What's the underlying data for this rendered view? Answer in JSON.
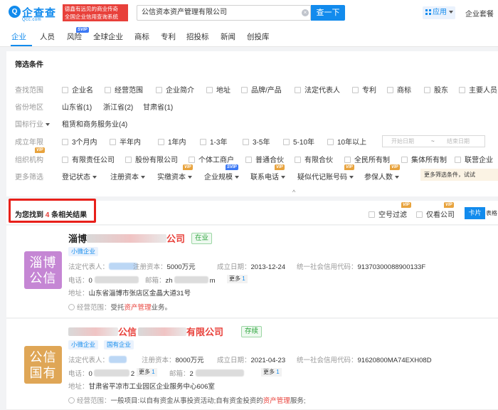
{
  "header": {
    "logo_mark": "Q",
    "logo_name": "企查查",
    "logo_domain": "Qcc.com",
    "slogan_line1": "德鑫有远见的商业传奇",
    "slogan_line2": "全国企业信用查询系统",
    "search_value": "公信资本资产管理有限公司",
    "search_button": "查一下",
    "app_button": "应用",
    "enterprise_kit": "企业套餐"
  },
  "nav": {
    "tabs": [
      "企业",
      "人员",
      "风险",
      "全球企业",
      "商标",
      "专利",
      "招投标",
      "新闻",
      "创投库"
    ],
    "risk_badge": "SVIP"
  },
  "filters": {
    "title": "筛选条件",
    "search_scope": {
      "label": "查找范围",
      "options": [
        "企业名",
        "经营范围",
        "企业简介",
        "地址",
        "品牌/产品",
        "法定代表人",
        "专利",
        "商标",
        "股东",
        "主要人员"
      ]
    },
    "province": {
      "label": "省份地区",
      "options": [
        "山东省(1)",
        "浙江省(2)",
        "甘肃省(1)"
      ]
    },
    "industry": {
      "label": "国标行业",
      "options": [
        "租赁和商务服务业(4)"
      ]
    },
    "established": {
      "label": "成立年限",
      "options": [
        "3个月内",
        "半年内",
        "1年内",
        "1-3年",
        "3-5年",
        "5-10年",
        "10年以上"
      ],
      "start_placeholder": "开始日期",
      "separator": "~",
      "end_placeholder": "结束日期"
    },
    "org_type": {
      "label": "组织机构",
      "badge": "VIP",
      "options": [
        "有限责任公司",
        "股份有限公司",
        "个体工商户",
        "普通合伙",
        "有限合伙",
        "全民所有制",
        "集体所有制",
        "联营企业"
      ]
    },
    "more": {
      "label": "更多筛选",
      "dropdowns": [
        "登记状态",
        "注册资本",
        "实缴资本",
        "企业规模",
        "联系电话",
        "疑似代记账号码",
        "参保人数"
      ],
      "badges": {
        "paid_capital": "VIP",
        "scale": "SVIP",
        "phone": "VIP",
        "bookkeeping": "VIP",
        "insured": "VIP"
      },
      "hint": "更多筛选条件，试试"
    },
    "collapse_icon": "^"
  },
  "results": {
    "prefix": "为您找到",
    "count": "4",
    "suffix": "条相关结果",
    "empty_filter": "空号过滤",
    "only_company": "仅看公司",
    "badge_vip": "VIP",
    "view_card": "卡片",
    "view_table": "表格"
  },
  "companies": [
    {
      "logo_line1": "淄博",
      "logo_line2": "公信",
      "name_prefix": "淄博",
      "name_suffix": "公司",
      "status": "在业",
      "tags": [
        "小微企业"
      ],
      "legal_rep_label": "法定代表人：",
      "reg_capital_label": "注册资本：",
      "reg_capital": "5000万元",
      "est_date_label": "成立日期：",
      "est_date": "2013-12-24",
      "credit_code_label": "统一社会信用代码：",
      "credit_code": "91370300088900133F",
      "phone_label": "电话：",
      "phone": "0",
      "email_label": "邮箱：",
      "email_start": "zh",
      "email_end": "m",
      "email_more": "更多",
      "email_more_n": "1",
      "address_label": "地址：",
      "address": "山东省淄博市张店区金晶大道31号",
      "scope_label": "经营范围：",
      "scope_pre": "受托",
      "scope_hl": "资产管理",
      "scope_post": "业务。"
    },
    {
      "logo_line1": "公信",
      "logo_line2": "国有",
      "name_mid": "公信",
      "name_tail": "有限公司",
      "status": "存续",
      "tags": [
        "小微企业",
        "国有企业"
      ],
      "legal_rep_label": "法定代表人：",
      "reg_capital_label": "注册资本：",
      "reg_capital": "8000万元",
      "est_date_label": "成立日期：",
      "est_date": "2021-04-23",
      "credit_code_label": "统一社会信用代码：",
      "credit_code": "91620800MA74EXH08D",
      "phone_label": "电话：",
      "phone_start": "0",
      "phone_end": "2",
      "phone_more": "更多",
      "phone_more_n": "1",
      "email_label": "邮箱：",
      "email_start": "2",
      "email_more": "更多",
      "email_more_n": "1",
      "address_label": "地址：",
      "address": "甘肃省平凉市工业园区企业服务中心606室",
      "scope_label": "经营范围：",
      "scope_pre": "一般项目:以自有资金从事投资活动;自有资金投资的",
      "scope_hl": "资产管理",
      "scope_post": "服务;"
    }
  ],
  "colors": {
    "brand": "#128bed",
    "highlight": "#e8403a",
    "status_green": "#2ca53b",
    "annotation_box": "#e8201a",
    "vip_gold": "#e8a33d",
    "svip_blue": "#3c79f5"
  }
}
